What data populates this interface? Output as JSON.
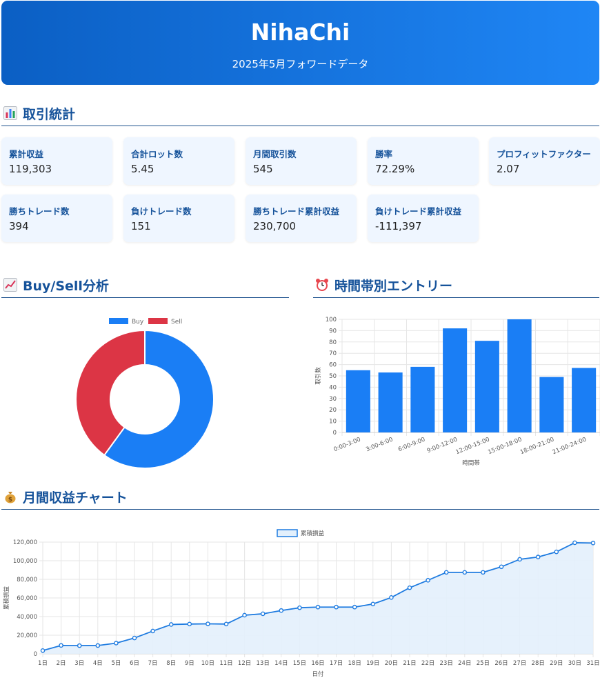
{
  "header": {
    "title": "NihaChi",
    "subtitle": "2025年5月フォワードデータ"
  },
  "stats": {
    "heading": "取引統計",
    "cards": [
      {
        "label": "累計収益",
        "value": "119,303"
      },
      {
        "label": "合計ロット数",
        "value": "5.45"
      },
      {
        "label": "月間取引数",
        "value": "545"
      },
      {
        "label": "勝率",
        "value": "72.29%"
      },
      {
        "label": "プロフィットファクター",
        "value": "2.07"
      },
      {
        "label": "勝ちトレード数",
        "value": "394"
      },
      {
        "label": "負けトレード数",
        "value": "151"
      },
      {
        "label": "勝ちトレード累計収益",
        "value": "230,700"
      },
      {
        "label": "負けトレード累計収益",
        "value": "-111,397"
      }
    ]
  },
  "buysell": {
    "heading": "Buy/Sell分析"
  },
  "timeband": {
    "heading": "時間帯別エントリー"
  },
  "monthly": {
    "heading": "月間収益チャート"
  },
  "colors": {
    "buy": "#1a7ef5",
    "sell": "#dc3545",
    "accent": "#15529a",
    "line": "#1e7be0",
    "area": "#e3f0fc"
  },
  "chart_data": [
    {
      "type": "pie",
      "variant": "doughnut",
      "categories": [
        "Buy",
        "Sell"
      ],
      "values": [
        60,
        40
      ],
      "legend": "top"
    },
    {
      "type": "bar",
      "categories": [
        "0:00-3:00",
        "3:00-6:00",
        "6:00-9:00",
        "9:00-12:00",
        "12:00-15:00",
        "15:00-18:00",
        "18:00-21:00",
        "21:00-24:00"
      ],
      "values": [
        55,
        53,
        58,
        92,
        81,
        100,
        49,
        57
      ],
      "xlabel": "時間帯",
      "ylabel": "取引数",
      "ylim": [
        0,
        100
      ],
      "yticks": [
        0,
        10,
        20,
        30,
        40,
        50,
        60,
        70,
        80,
        90,
        100
      ],
      "grid": true
    },
    {
      "type": "area",
      "x": [
        "1日",
        "2日",
        "3日",
        "4日",
        "5日",
        "6日",
        "7日",
        "8日",
        "9日",
        "10日",
        "11日",
        "12日",
        "13日",
        "14日",
        "15日",
        "16日",
        "17日",
        "18日",
        "19日",
        "20日",
        "21日",
        "22日",
        "23日",
        "24日",
        "25日",
        "26日",
        "27日",
        "28日",
        "29日",
        "30日",
        "31日"
      ],
      "series": [
        {
          "name": "累積損益",
          "values": [
            3500,
            9000,
            8800,
            8900,
            11500,
            17000,
            24500,
            31500,
            32000,
            32200,
            32000,
            41500,
            43000,
            46500,
            49500,
            50200,
            50200,
            50200,
            53500,
            60500,
            71000,
            79000,
            87500,
            87500,
            87500,
            93500,
            101500,
            104000,
            109500,
            119303,
            119000
          ]
        }
      ],
      "xlabel": "日付",
      "ylabel": "累積損益",
      "ylim": [
        0,
        120000
      ],
      "yticks": [
        "0",
        "20,000",
        "40,000",
        "60,000",
        "80,000",
        "100,000",
        "120,000"
      ],
      "grid": true,
      "legend": "top"
    }
  ]
}
